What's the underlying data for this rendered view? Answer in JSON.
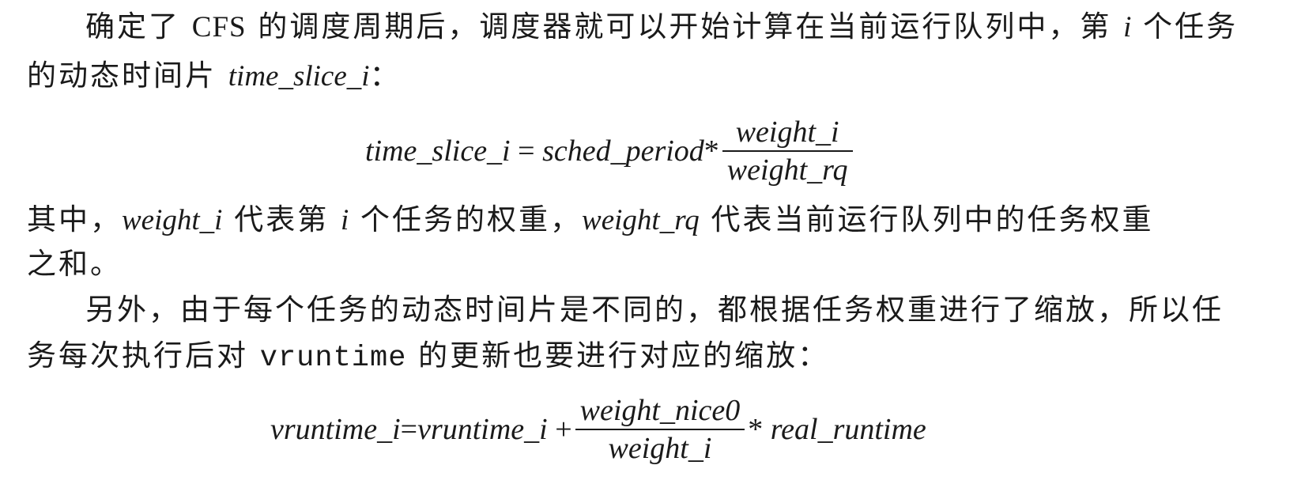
{
  "paragraph1": {
    "line1_a": "确定了 ",
    "cfs": "CFS",
    "line1_b": " 的调度周期后，调度器就可以开始计算在当前运行队列中，第 ",
    "var_i": "i",
    "line1_c": " 个任务",
    "line2_a": "的动态时间片 ",
    "var_time_slice_i": "time_slice_i",
    "line2_b": "："
  },
  "formula1": {
    "lhs": "time_slice_i",
    "equals": " = ",
    "factor": "sched_period",
    "times": "*",
    "numerator": "weight_i",
    "denominator": "weight_rq"
  },
  "paragraph2": {
    "line1_a": "其中，",
    "var_weight_i": "weight_i",
    "line1_b": " 代表第 ",
    "var_i": "i",
    "line1_c": " 个任务的权重，",
    "var_weight_rq": "weight_rq",
    "line1_d": " 代表当前运行队列中的任务权重",
    "line2": "之和。"
  },
  "paragraph3": {
    "line1": "另外，由于每个任务的动态时间片是不同的，都根据任务权重进行了缩放，所以任",
    "line2_a": "务每次执行后对 ",
    "code_vruntime": "vruntime",
    "line2_b": " 的更新也要进行对应的缩放："
  },
  "formula2": {
    "lhs": "vruntime_i",
    "equals": "=",
    "rhs_term": "vruntime_i",
    "plus": " +",
    "numerator": "weight_nice0",
    "denominator": "weight_i",
    "times": "* ",
    "factor": "real_runtime"
  }
}
